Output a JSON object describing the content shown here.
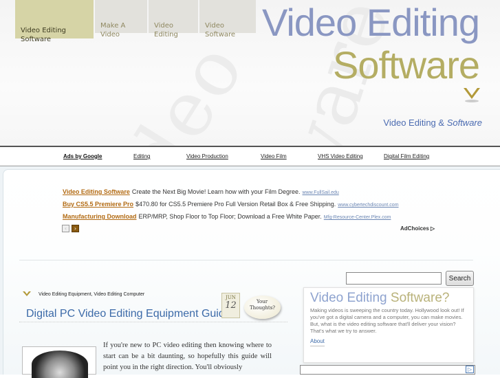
{
  "nav": [
    {
      "label": "Video Editing Software",
      "active": true
    },
    {
      "label": "Make A Video"
    },
    {
      "label": "Video Editing"
    },
    {
      "label": "Video Software"
    }
  ],
  "logo": {
    "line1": "Video Editing",
    "line2": "Software"
  },
  "watermark": {
    "w1": "Video",
    "w2": "Software"
  },
  "tagline": {
    "a": "Video Editing & ",
    "b": "Software"
  },
  "linkbar": {
    "ads": "Ads by Google",
    "links": [
      "Editing",
      "Video Production",
      "Video Film",
      "VHS Video Editing",
      "Digital Film Editing"
    ]
  },
  "ads": [
    {
      "title": "Video Editing Software",
      "text": "Create the Next Big Movie! Learn how with your Film Degree.",
      "url": "www.FullSail.edu"
    },
    {
      "title": "Buy CS5.5 Premiere Pro",
      "text": "$470.80 for CS5.5 Premiere Pro Full Version Retail Box & Free Shipping.",
      "url": "www.cybertechdiscount.com"
    },
    {
      "title": "Manufacturing Download",
      "text": "ERP/MRP, Shop Floor to Top Floor; Download a Free White Paper.",
      "url": "Mfg-Resource-Center.Plex.com"
    }
  ],
  "adchoices": "AdChoices",
  "search": {
    "button": "Search",
    "placeholder": ""
  },
  "post": {
    "categories": "Video Editing Equipment, Video Editing Computer",
    "title": "Digital PC Video Editing Equipment Guide",
    "date_month": "JUN",
    "date_day": "12",
    "bubble": "Your Thoughts?",
    "text": "If you're new to PC video editing then knowing where to start can be a bit daunting, so hopefully this guide will point you in the right direction. You'll obviously"
  },
  "sidebar": {
    "title_a": "Video Editing",
    "title_b": "Software?",
    "text": "Making videos is sweeping the country today. Hollywood look out! If you've got a digital camera and a computer, you can make movies. But, what is the video editing software that'll deliver your vision? That's what we try to answer.",
    "about": "About"
  },
  "colors": {
    "accent": "#3c6aa8",
    "nav_active": "#d6d4a6",
    "gold": "#b4ad63"
  }
}
